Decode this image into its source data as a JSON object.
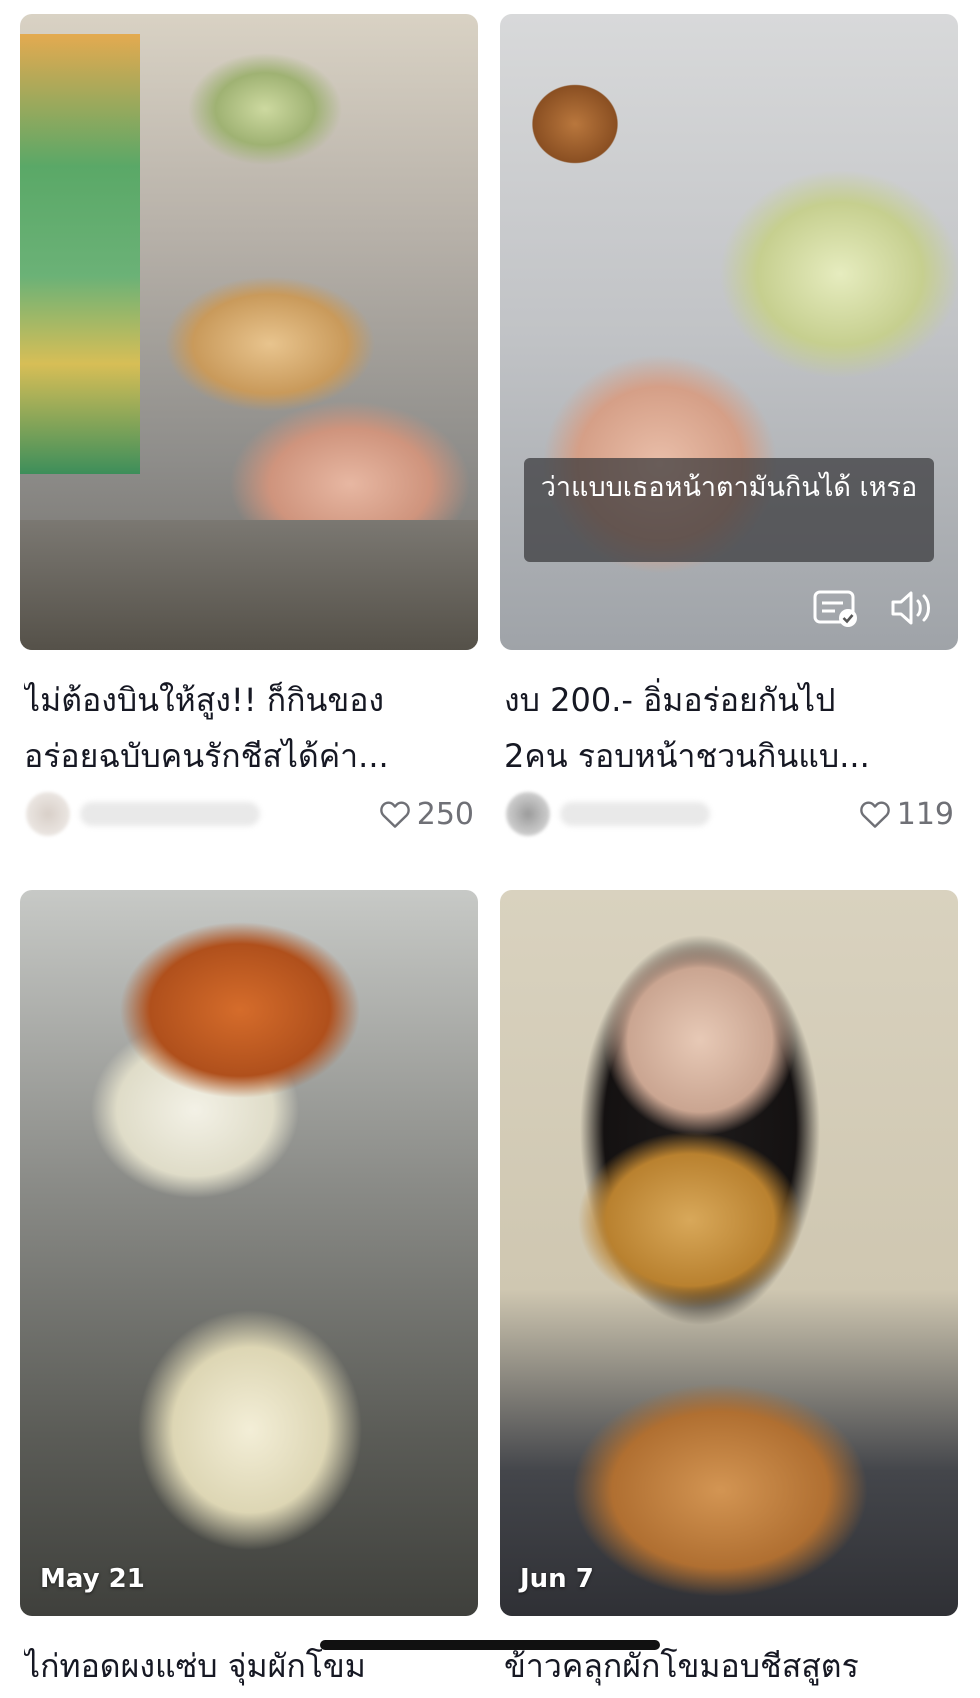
{
  "posts": [
    {
      "title_line1": "ไม่ต้องบินให้สูง!! ก็กินของ",
      "title_line2": "อร่อยฉบับคนรักชีสได้ค่า...",
      "likes": "250",
      "thumbnail": "cheesy-spinach-toast-photo"
    },
    {
      "overlay_caption": "ว่าแบบเธอหน้าตามันกินได้ เหรอ",
      "title_line1": "งบ 200.- อิ่มอร่อยกันไป",
      "title_line2": "2คน รอบหน้าชวนกินแบ...",
      "likes": "119",
      "thumbnail": "spinach-cheese-bowl-photo",
      "icons": [
        "captions-icon",
        "speaker-icon"
      ]
    },
    {
      "date": "May 21",
      "title_line1": "ไก่ทอดผงแซ่บ จุ่มผักโขม",
      "thumbnail": "fried-chicken-cheese-dip-photo"
    },
    {
      "date": "Jun 7",
      "title_line1": "ข้าวคลุกผักโขมอบชีสสูตร",
      "thumbnail": "spinach-rice-bowl-photo"
    }
  ],
  "icons": {
    "like": "heart-outline-icon"
  }
}
